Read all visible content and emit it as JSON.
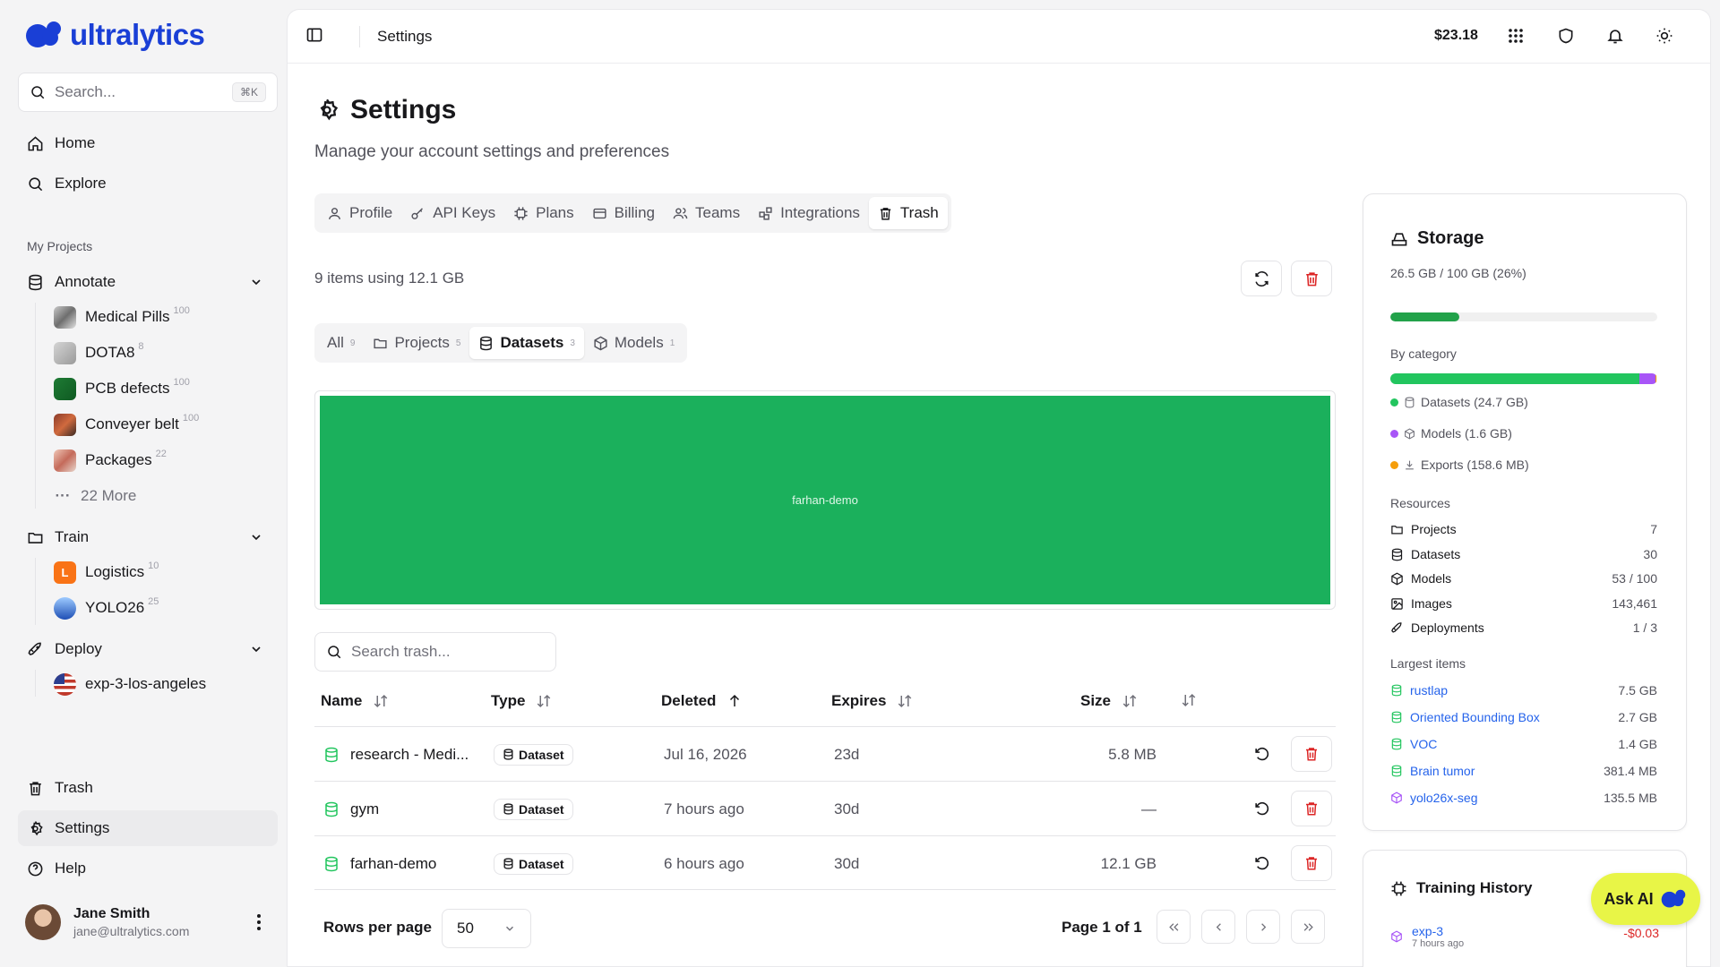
{
  "app": {
    "logo_text": "ultralytics"
  },
  "search": {
    "placeholder": "Search...",
    "shortcut": "⌘K"
  },
  "nav": {
    "home": "Home",
    "explore": "Explore",
    "trash": "Trash",
    "settings": "Settings",
    "help": "Help"
  },
  "sidebar": {
    "my_projects_label": "My Projects",
    "annotate": {
      "label": "Annotate",
      "items": [
        {
          "label": "Medical Pills",
          "count": "100"
        },
        {
          "label": "DOTA8",
          "count": "8"
        },
        {
          "label": "PCB defects",
          "count": "100"
        },
        {
          "label": "Conveyer belt",
          "count": "100"
        },
        {
          "label": "Packages",
          "count": "22"
        }
      ],
      "more": "22 More"
    },
    "train": {
      "label": "Train",
      "items": [
        {
          "label": "Logistics",
          "count": "10",
          "initial": "L"
        },
        {
          "label": "YOLO26",
          "count": "25"
        }
      ]
    },
    "deploy": {
      "label": "Deploy",
      "items": [
        {
          "label": "exp-3-los-angeles"
        }
      ]
    }
  },
  "user": {
    "name": "Jane Smith",
    "email": "jane@ultralytics.com"
  },
  "topbar": {
    "breadcrumb": "Settings",
    "balance": "$23.18"
  },
  "page": {
    "title": "Settings",
    "subtitle": "Manage your account settings and preferences"
  },
  "tabs": [
    "Profile",
    "API Keys",
    "Plans",
    "Billing",
    "Teams",
    "Integrations",
    "Trash"
  ],
  "trash": {
    "summary": "9 items using 12.1 GB",
    "filters": [
      {
        "label": "All",
        "count": "9"
      },
      {
        "label": "Projects",
        "count": "5"
      },
      {
        "label": "Datasets",
        "count": "3"
      },
      {
        "label": "Models",
        "count": "1"
      }
    ],
    "treemap_label": "farhan-demo",
    "search_placeholder": "Search trash...",
    "columns": {
      "name": "Name",
      "type": "Type",
      "deleted": "Deleted",
      "expires": "Expires",
      "size": "Size"
    },
    "rows": [
      {
        "name": "research - Medi...",
        "type": "Dataset",
        "deleted": "Jul 16, 2026",
        "expires": "23d",
        "size": "5.8 MB"
      },
      {
        "name": "gym",
        "type": "Dataset",
        "deleted": "7 hours ago",
        "expires": "30d",
        "size": "—"
      },
      {
        "name": "farhan-demo",
        "type": "Dataset",
        "deleted": "6 hours ago",
        "expires": "30d",
        "size": "12.1 GB"
      }
    ],
    "rows_per_page_label": "Rows per page",
    "rows_per_page": "50",
    "page_info": "Page 1 of 1"
  },
  "storage": {
    "title": "Storage",
    "usage": "26.5 GB / 100 GB (26%)",
    "usage_fraction": 0.26,
    "by_category_label": "By category",
    "categories": [
      {
        "label": "Datasets (24.7 GB)",
        "color": "#22c55e",
        "fraction": 0.932
      },
      {
        "label": "Models (1.6 GB)",
        "color": "#a855f7",
        "fraction": 0.06
      },
      {
        "label": "Exports (158.6 MB)",
        "color": "#f59e0b",
        "fraction": 0.006
      }
    ],
    "resources_label": "Resources",
    "resources": [
      {
        "label": "Projects",
        "value": "7",
        "icon": "folder-icon"
      },
      {
        "label": "Datasets",
        "value": "30",
        "icon": "database-icon"
      },
      {
        "label": "Models",
        "value": "53 / 100",
        "icon": "cube-icon"
      },
      {
        "label": "Images",
        "value": "143,461",
        "icon": "image-icon"
      },
      {
        "label": "Deployments",
        "value": "1 / 3",
        "icon": "rocket-icon"
      }
    ],
    "largest_label": "Largest items",
    "largest": [
      {
        "label": "rustlap",
        "value": "7.5 GB",
        "kind": "dataset"
      },
      {
        "label": "Oriented Bounding Box",
        "value": "2.7 GB",
        "kind": "dataset"
      },
      {
        "label": "VOC",
        "value": "1.4 GB",
        "kind": "dataset"
      },
      {
        "label": "Brain tumor",
        "value": "381.4 MB",
        "kind": "dataset"
      },
      {
        "label": "yolo26x-seg",
        "value": "135.5 MB",
        "kind": "model"
      }
    ]
  },
  "training": {
    "title": "Training History",
    "items": [
      {
        "name": "exp-3",
        "time": "7 hours ago",
        "cost": "-$0.03"
      }
    ]
  },
  "ask_ai": "Ask AI"
}
